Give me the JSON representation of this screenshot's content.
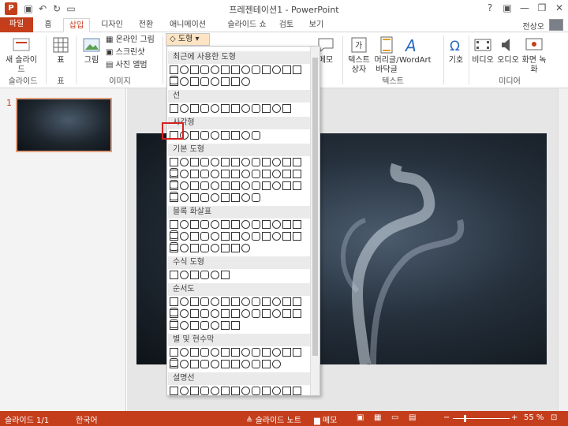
{
  "app": {
    "title": "프레젠테이션1 - PowerPoint",
    "logo": "P"
  },
  "window": {
    "help": "?",
    "minimize": "—",
    "restore": "❐",
    "close": "✕"
  },
  "tabs": {
    "file": "파일",
    "home": "홈",
    "insert": "삽입",
    "design": "디자인",
    "transitions": "전환",
    "animations": "애니메이션",
    "slideshow": "슬라이드 쇼",
    "review": "검토",
    "view": "보기",
    "user": "전상오"
  },
  "ribbon": {
    "new_slide": "새 슬라이드",
    "slides_group": "슬라이드",
    "table": "표",
    "tables_group": "표",
    "pictures": "그림",
    "online_pictures": "온라인 그림",
    "screenshot": "스크린샷",
    "photo_album": "사진 앨범",
    "images_group": "이미지",
    "shapes": "도형",
    "memo": "메모",
    "textbox": "텍스트 상자",
    "header_footer": "머리글/ 바닥글",
    "wordart": "WordArt",
    "text_group": "텍스트",
    "symbol": "기호",
    "video": "비디오",
    "audio": "오디오",
    "screen_recording": "화면 녹화",
    "media_group": "미디어"
  },
  "dropdown": {
    "sections": [
      "최근에 사용한 도형",
      "선",
      "사각형",
      "기본 도형",
      "블록 화살표",
      "수식 도형",
      "순서도",
      "별 및 현수막",
      "설명선"
    ],
    "shape_counts": [
      [
        14,
        8
      ],
      [
        12
      ],
      [
        9
      ],
      [
        14,
        14,
        14,
        9
      ],
      [
        14,
        14,
        8
      ],
      [
        6
      ],
      [
        14,
        14,
        7
      ],
      [
        14,
        11
      ],
      [
        14,
        7
      ]
    ]
  },
  "slide_panel": {
    "number": "1"
  },
  "status": {
    "slide": "슬라이드 1/1",
    "lang": "한국어",
    "notes": "슬라이드 노트",
    "memo": "메모",
    "zoom": "55 %"
  },
  "colors": {
    "accent": "#c43e1c"
  }
}
